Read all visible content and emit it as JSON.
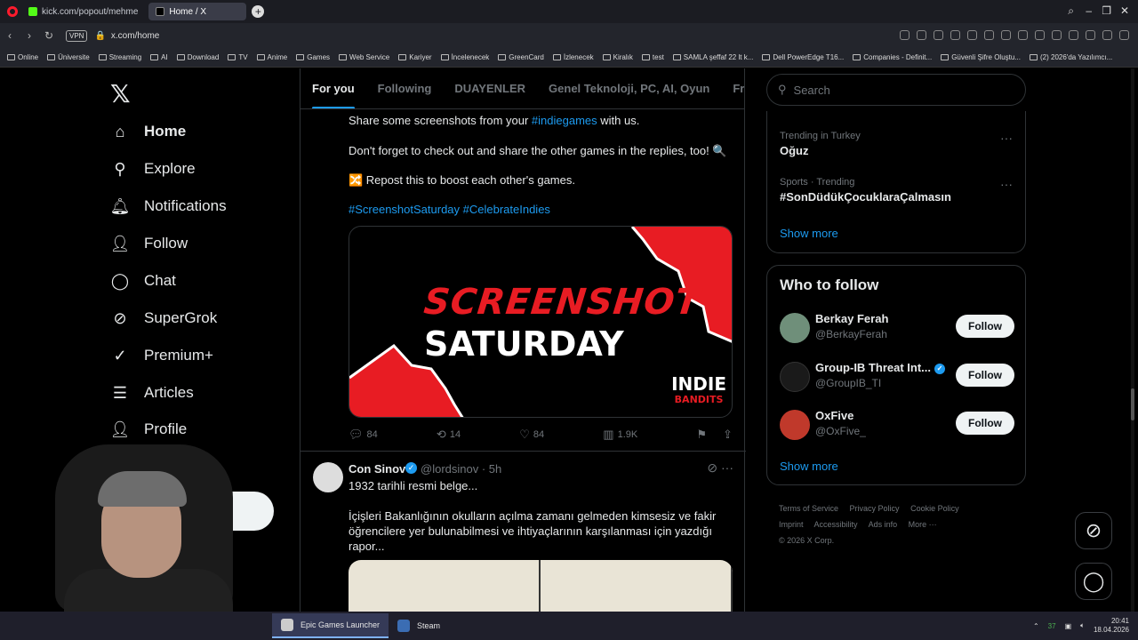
{
  "browser": {
    "tabs": [
      {
        "label": "kick.com/popout/mehme"
      },
      {
        "label": "Home / X"
      }
    ],
    "url": "x.com/home",
    "vpn_label": "VPN",
    "bookmarks": [
      "Online",
      "Üniversite",
      "Streaming",
      "AI",
      "Download",
      "TV",
      "Anime",
      "Games",
      "Web Service",
      "Kariyer",
      "İncelenecek",
      "GreenCard",
      "İzlenecek",
      "Kiralık",
      "test",
      "SAMLA şeffaf 22 lt k...",
      "Dell PowerEdge T16...",
      "Companies - Definit...",
      "Güvenli Şifre Oluştu...",
      "(2) 2026'da Yazılımcı..."
    ]
  },
  "sidebar": {
    "items": [
      {
        "label": "Home",
        "icon": "home-icon"
      },
      {
        "label": "Explore",
        "icon": "search-icon"
      },
      {
        "label": "Notifications",
        "icon": "bell-icon"
      },
      {
        "label": "Follow",
        "icon": "add-person-icon"
      },
      {
        "label": "Chat",
        "icon": "chat-icon"
      },
      {
        "label": "SuperGrok",
        "icon": "grok-icon"
      },
      {
        "label": "Premium+",
        "icon": "premium-icon"
      },
      {
        "label": "Articles",
        "icon": "articles-icon"
      },
      {
        "label": "Profile",
        "icon": "profile-icon"
      }
    ]
  },
  "timeline": {
    "tabs": [
      "For you",
      "Following",
      "DUAYENLER",
      "Genel Teknoloji, PC, AI, Oyun",
      "Free G"
    ],
    "tweet1": {
      "line1_prefix": "Share some screenshots from your ",
      "line1_tag": "#indiegames",
      "line1_suffix": " with us.",
      "line2": "Don't forget to check out and share the other games in the replies, too! 🔍",
      "line3": "🔀 Repost this to boost each other's games.",
      "tags": "#ScreenshotSaturday #CelebrateIndies",
      "media_title": "SCREENSHOT",
      "media_subtitle": "SATURDAY",
      "media_brand": "INDIE",
      "media_brand2": "BANDITS",
      "replies": "84",
      "reposts": "14",
      "likes": "84",
      "views": "1.9K"
    },
    "tweet2": {
      "name": "Con Sinov",
      "handle": "@lordsinov · 5h",
      "text1": "1932 tarihli resmi belge...",
      "text2": "İçişleri Bakanlığının okulların açılma zamanı gelmeden kimsesiz ve fakir öğrencilere yer bulunabilmesi ve ihtiyaçlarının karşılanması için yazdığı rapor..."
    }
  },
  "right": {
    "search_placeholder": "Search",
    "trends": [
      {
        "category": "Trending in Turkey",
        "name": "Oğuz"
      },
      {
        "category": "Sports · Trending",
        "name": "#SonDüdükÇocuklaraÇalmasın"
      }
    ],
    "trends_show_more": "Show more",
    "who_to_follow": {
      "title": "Who to follow",
      "accounts": [
        {
          "name": "Berkay Ferah",
          "handle": "@BerkayFerah",
          "verified": false,
          "avatar_color": "#6f8f7a"
        },
        {
          "name": "Group-IB Threat Int...",
          "handle": "@GroupIB_TI",
          "verified": true,
          "avatar_color": "#1a1a1a"
        },
        {
          "name": "OxFive",
          "handle": "@OxFive_",
          "verified": false,
          "avatar_color": "#c0392b"
        }
      ],
      "follow_label": "Follow",
      "show_more": "Show more"
    },
    "footer": [
      "Terms of Service",
      "Privacy Policy",
      "Cookie Policy",
      "Imprint",
      "Accessibility",
      "Ads info",
      "More ···",
      "© 2026 X Corp."
    ]
  },
  "taskbar": {
    "items": [
      "Epic Games Launcher",
      "Steam"
    ],
    "tray_count": "37",
    "time": "20:41",
    "date": "18.04.2026"
  },
  "colors": {
    "accent": "#1d9bf0",
    "screenshot_red": "#e81c23"
  }
}
